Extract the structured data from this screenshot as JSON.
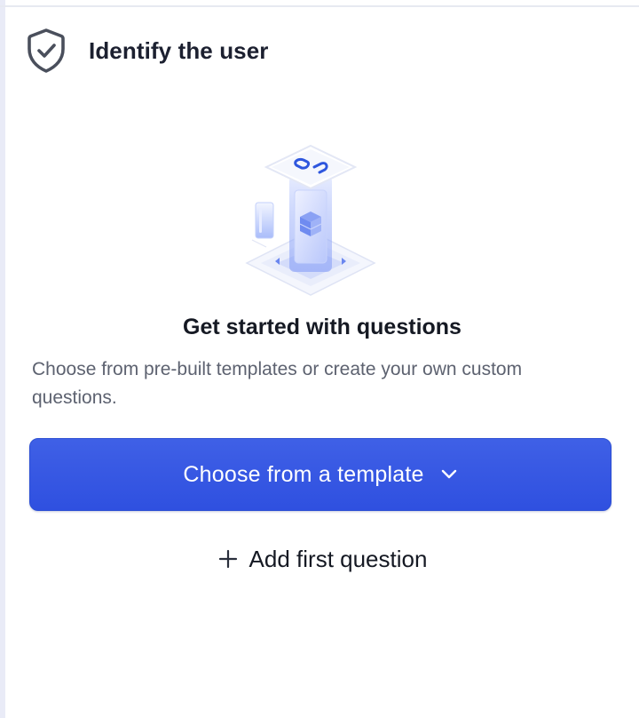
{
  "header": {
    "title": "Identify the user",
    "icon": "shield-check-icon"
  },
  "empty_state": {
    "illustration": "questions-illustration",
    "heading": "Get started with questions",
    "description": "Choose from pre-built templates or create your own custom questions."
  },
  "actions": {
    "template_button_label": "Choose from a template",
    "template_button_icon": "chevron-down-icon",
    "add_question_label": "Add first question",
    "add_question_icon": "plus-icon"
  },
  "colors": {
    "primary": "#3556E3",
    "text_primary": "#151923",
    "text_secondary": "#5D6270"
  }
}
